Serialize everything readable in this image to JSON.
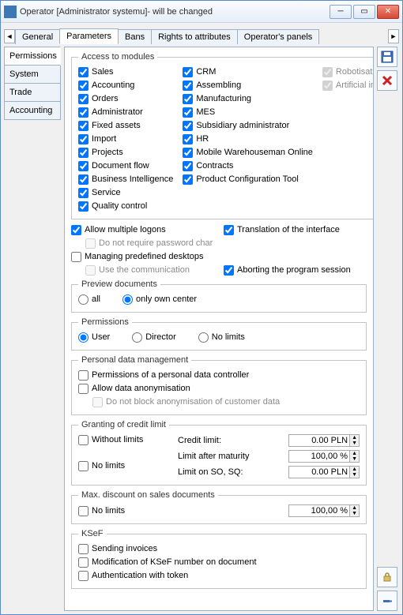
{
  "window": {
    "title": "Operator [Administrator systemu]- will be changed"
  },
  "tabs": {
    "general": "General",
    "parameters": "Parameters",
    "bans": "Bans",
    "rights": "Rights to attributes",
    "panels": "Operator's panels"
  },
  "sidetabs": {
    "permissions": "Permissions",
    "system": "System",
    "trade": "Trade",
    "accounting": "Accounting"
  },
  "access": {
    "legend": "Access to modules",
    "col1": {
      "sales": "Sales",
      "accounting": "Accounting",
      "orders": "Orders",
      "administrator": "Administrator",
      "fixed_assets": "Fixed assets",
      "import": "Import",
      "projects": "Projects",
      "document_flow": "Document flow",
      "bi": "Business Intelligence",
      "service": "Service",
      "qc": "Quality control"
    },
    "col2": {
      "crm": "CRM",
      "assembling": "Assembling",
      "manufacturing": "Manufacturing",
      "mes": "MES",
      "subsidiary": "Subsidiary administrator",
      "hr": "HR",
      "mwo": "Mobile Warehouseman Online",
      "contracts": "Contracts",
      "pct": "Product Configuration Tool"
    },
    "col3": {
      "rpa": "Robotisation (RPA)",
      "ai": "Artificial intel. (AI)"
    }
  },
  "misc": {
    "allow_multiple": "Allow multiple logons",
    "no_pwd_char": "Do not require password char",
    "translation": "Translation of the interface",
    "predef_desktops": "Managing predefined desktops",
    "use_comm": "Use the communication",
    "abort_session": "Aborting the program session"
  },
  "preview": {
    "legend": "Preview documents",
    "all": "all",
    "own": "only own center"
  },
  "perm": {
    "legend": "Permissions",
    "user": "User",
    "director": "Director",
    "nolimits": "No limits"
  },
  "pdm": {
    "legend": "Personal data management",
    "controller": "Permissions of a personal data controller",
    "anon": "Allow data anonymisation",
    "noblock": "Do not block anonymisation of customer data"
  },
  "credit": {
    "legend": "Granting of credit limit",
    "without": "Without limits",
    "nolimits": "No limits",
    "credit_limit_lab": "Credit limit:",
    "limit_after_lab": "Limit after maturity",
    "limit_so_lab": "Limit on SO, SQ:",
    "credit_limit_val": "0.00 PLN",
    "limit_after_val": "100,00 %",
    "limit_so_val": "0.00 PLN"
  },
  "maxdisc": {
    "legend": "Max. discount on sales documents",
    "nolimits": "No limits",
    "val": "100,00 %"
  },
  "ksef": {
    "legend": "KSeF",
    "sending": "Sending invoices",
    "mod": "Modification of KSeF number on document",
    "auth": "Authentication with token"
  }
}
